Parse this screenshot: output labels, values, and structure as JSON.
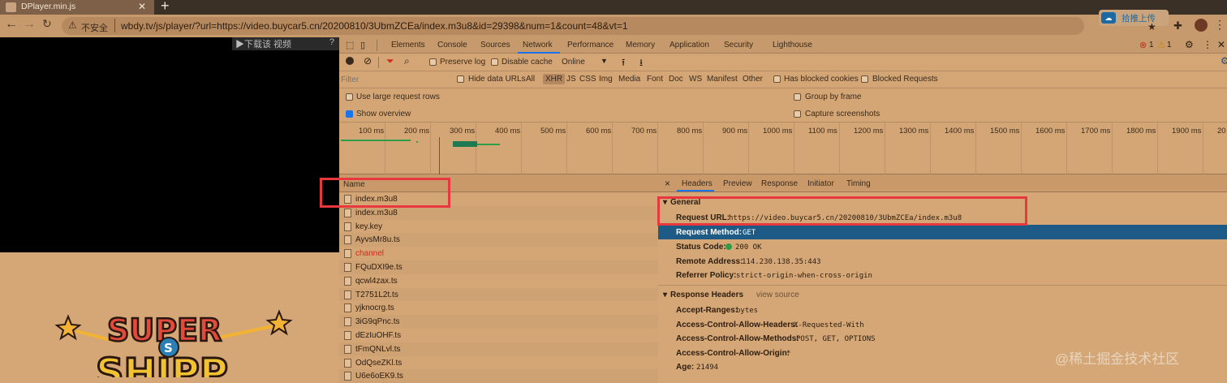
{
  "browser": {
    "tab_title": "DPlayer.min.js",
    "insecure_label": "不安全",
    "url": "wbdy.tv/js/player/?url=https://video.buycar5.cn/20200810/3UbmZCEa/index.m3u8&id=29398&num=1&count=48&vt=1",
    "extension_label": "拾推上传"
  },
  "player": {
    "download_bar": "▶下载该 视频",
    "download_help": "?",
    "logo_line1": "SUPER",
    "logo_badge": "S",
    "logo_line2": "SHIPP"
  },
  "devtools": {
    "tabs": [
      "Elements",
      "Console",
      "Sources",
      "Network",
      "Performance",
      "Memory",
      "Application",
      "Security",
      "Lighthouse"
    ],
    "active_tab": "Network",
    "error_count": "1",
    "warning_count": "1",
    "toolbar": {
      "preserve_log": "Preserve log",
      "disable_cache": "Disable cache",
      "throttle": "Online"
    },
    "filter": {
      "placeholder": "Filter",
      "hide_data_urls": "Hide data URLs",
      "types": [
        "All",
        "XHR",
        "JS",
        "CSS",
        "Img",
        "Media",
        "Font",
        "Doc",
        "WS",
        "Manifest",
        "Other"
      ],
      "active_type": "XHR",
      "has_blocked_cookies": "Has blocked cookies",
      "blocked_requests": "Blocked Requests"
    },
    "options": {
      "large_rows": "Use large request rows",
      "show_overview": "Show overview",
      "group_by_frame": "Group by frame",
      "capture_screenshots": "Capture screenshots"
    },
    "timeline_ticks": [
      "100 ms",
      "200 ms",
      "300 ms",
      "400 ms",
      "500 ms",
      "600 ms",
      "700 ms",
      "800 ms",
      "900 ms",
      "1000 ms",
      "1100 ms",
      "1200 ms",
      "1300 ms",
      "1400 ms",
      "1500 ms",
      "1600 ms",
      "1700 ms",
      "1800 ms",
      "1900 ms",
      "20"
    ],
    "requests": {
      "header": "Name",
      "items": [
        {
          "name": "index.m3u8",
          "color": "#2b1d10"
        },
        {
          "name": "index.m3u8",
          "color": "#2b1d10"
        },
        {
          "name": "key.key",
          "color": "#2b1d10"
        },
        {
          "name": "AyvsMr8u.ts",
          "color": "#2b1d10"
        },
        {
          "name": "channel",
          "color": "#d12a1a"
        },
        {
          "name": "FQuDXI9e.ts",
          "color": "#2b1d10"
        },
        {
          "name": "qcwl4zax.ts",
          "color": "#2b1d10"
        },
        {
          "name": "T2751L2t.ts",
          "color": "#2b1d10"
        },
        {
          "name": "yjknocrg.ts",
          "color": "#2b1d10"
        },
        {
          "name": "3iG9qPnc.ts",
          "color": "#2b1d10"
        },
        {
          "name": "dEzIuOHF.ts",
          "color": "#2b1d10"
        },
        {
          "name": "tFmQNLvl.ts",
          "color": "#2b1d10"
        },
        {
          "name": "OdQseZKl.ts",
          "color": "#2b1d10"
        },
        {
          "name": "U6e6oEK9.ts",
          "color": "#2b1d10"
        }
      ]
    },
    "detail": {
      "close": "×",
      "tabs": [
        "Headers",
        "Preview",
        "Response",
        "Initiator",
        "Timing"
      ],
      "active_tab": "Headers",
      "general_title": "General",
      "general": [
        {
          "key": "Request URL:",
          "value": "https://video.buycar5.cn/20200810/3UbmZCEa/index.m3u8"
        },
        {
          "key": "Request Method:",
          "value": "GET"
        },
        {
          "key": "Status Code:",
          "value": "200 OK"
        },
        {
          "key": "Remote Address:",
          "value": "114.230.138.35:443"
        },
        {
          "key": "Referrer Policy:",
          "value": "strict-origin-when-cross-origin"
        }
      ],
      "response_title": "Response Headers",
      "view_source": "view source",
      "response": [
        {
          "key": "Accept-Ranges:",
          "value": "bytes"
        },
        {
          "key": "Access-Control-Allow-Headers:",
          "value": "X-Requested-With"
        },
        {
          "key": "Access-Control-Allow-Methods:",
          "value": "POST, GET, OPTIONS"
        },
        {
          "key": "Access-Control-Allow-Origin:",
          "value": "*"
        },
        {
          "key": "Age:",
          "value": "21494"
        }
      ]
    }
  },
  "watermark": "@稀土掘金技术社区",
  "colors": {
    "highlight_box": "#e8383d",
    "status_ok": "#2e9d4a",
    "selection": "#1d5a86"
  }
}
